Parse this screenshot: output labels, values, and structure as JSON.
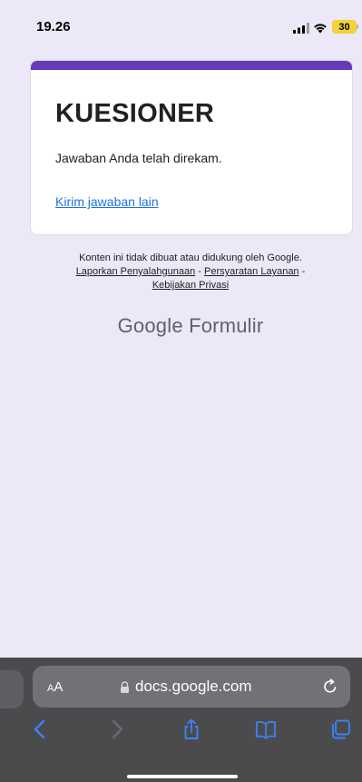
{
  "status_bar": {
    "time": "19.26",
    "battery_level": "30"
  },
  "form": {
    "title": "KUESIONER",
    "confirmation": "Jawaban Anda telah direkam.",
    "submit_another_link": "Kirim jawaban lain",
    "accent_color": "#673ab7"
  },
  "footer": {
    "disclaimer": "Konten ini tidak dibuat atau didukung oleh Google.",
    "report_abuse": "Laporkan Penyalahgunaan",
    "terms": "Persyaratan Layanan",
    "privacy": "Kebijakan Privasi",
    "separator": " - ",
    "brand_google": "Google",
    "brand_product": "Formulir"
  },
  "browser": {
    "aa_label_small": "A",
    "aa_label_large": "A",
    "url": "docs.google.com",
    "toolbar_icons": [
      "back-icon",
      "forward-icon",
      "share-icon",
      "bookmarks-icon",
      "tabs-icon"
    ]
  }
}
